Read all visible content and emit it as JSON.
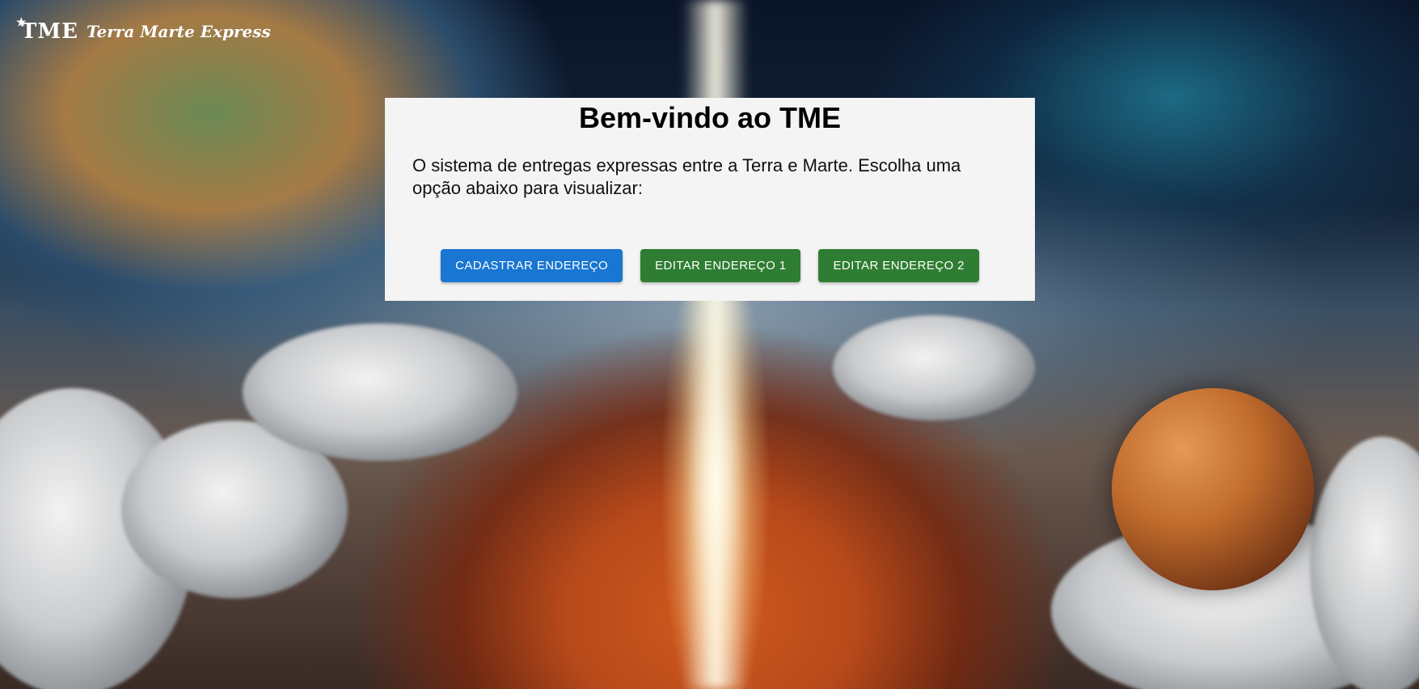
{
  "header": {
    "logo_mark": "TME",
    "logo_name": "Terra Marte Express"
  },
  "panel": {
    "title": "Bem-vindo ao TME",
    "description": "O sistema de entregas expressas entre a Terra e Marte. Escolha uma opção abaixo para visualizar:",
    "buttons": [
      {
        "label": "CADASTRAR ENDEREÇO",
        "color": "#1976d2"
      },
      {
        "label": "EDITAR ENDEREÇO 1",
        "color": "#2e7d32"
      },
      {
        "label": "EDITAR ENDEREÇO 2",
        "color": "#2e7d32"
      }
    ]
  }
}
